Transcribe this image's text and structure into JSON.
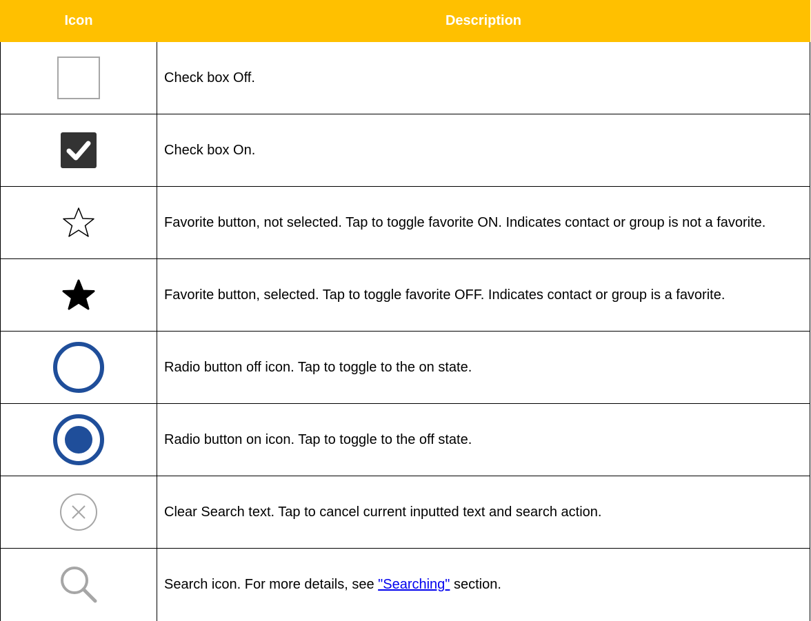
{
  "colors": {
    "header_bg": "#FFC000",
    "header_text": "#FFFFFF",
    "checkbox_on_bg": "#333333",
    "radio_blue": "#1F4E9A",
    "gray_icon": "#A6A6A6",
    "link": "#0000EE"
  },
  "header": {
    "icon_col": "Icon",
    "description_col": "Description"
  },
  "rows": [
    {
      "icon": "checkbox-off-icon",
      "description": "Check box Off."
    },
    {
      "icon": "checkbox-on-icon",
      "description": "Check box On."
    },
    {
      "icon": "star-outline-icon",
      "description": "Favorite button, not selected. Tap to toggle favorite ON. Indicates contact or group is not a favorite."
    },
    {
      "icon": "star-filled-icon",
      "description": "Favorite button, selected. Tap to toggle favorite OFF. Indicates contact or group is a favorite."
    },
    {
      "icon": "radio-off-icon",
      "description": "Radio button off icon. Tap to toggle to the on state."
    },
    {
      "icon": "radio-on-icon",
      "description": "Radio button on icon. Tap to toggle to the off state."
    },
    {
      "icon": "clear-search-icon",
      "description": "Clear Search text. Tap to cancel current inputted text and search action."
    },
    {
      "icon": "search-icon",
      "description_prefix": "Search icon. For more details, see ",
      "link_text": "\"Searching\"",
      "description_suffix": " section."
    }
  ]
}
